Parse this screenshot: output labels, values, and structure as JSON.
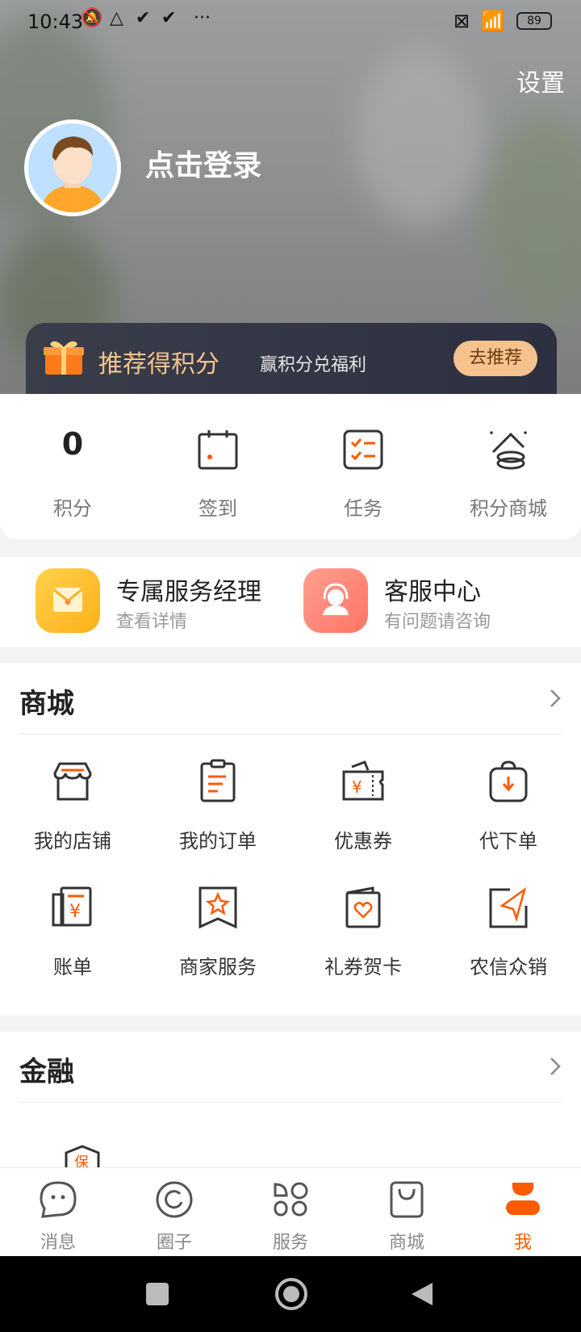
{
  "status": {
    "time": "10:43",
    "battery": "89"
  },
  "header": {
    "settings_label": "设置",
    "login_label": "点击登录"
  },
  "promo": {
    "title": "推荐得积分",
    "subtitle": "赢积分兑福利",
    "button": "去推荐"
  },
  "points_row": {
    "items": [
      {
        "value": "0",
        "label": "积分"
      },
      {
        "label": "签到"
      },
      {
        "label": "任务"
      },
      {
        "label": "积分商城"
      }
    ]
  },
  "services": [
    {
      "title": "专属服务经理",
      "subtitle": "查看详情"
    },
    {
      "title": "客服中心",
      "subtitle": "有问题请咨询"
    }
  ],
  "mall": {
    "title": "商城",
    "items": [
      {
        "label": "我的店铺"
      },
      {
        "label": "我的订单"
      },
      {
        "label": "优惠券"
      },
      {
        "label": "代下单"
      },
      {
        "label": "账单"
      },
      {
        "label": "商家服务"
      },
      {
        "label": "礼券贺卡"
      },
      {
        "label": "农信众销"
      }
    ]
  },
  "finance": {
    "title": "金融"
  },
  "tabbar": {
    "items": [
      {
        "label": "消息"
      },
      {
        "label": "圈子"
      },
      {
        "label": "服务"
      },
      {
        "label": "商城"
      },
      {
        "label": "我"
      }
    ]
  },
  "colors": {
    "accent": "#ff5a00",
    "gold": "#f6c38e"
  }
}
